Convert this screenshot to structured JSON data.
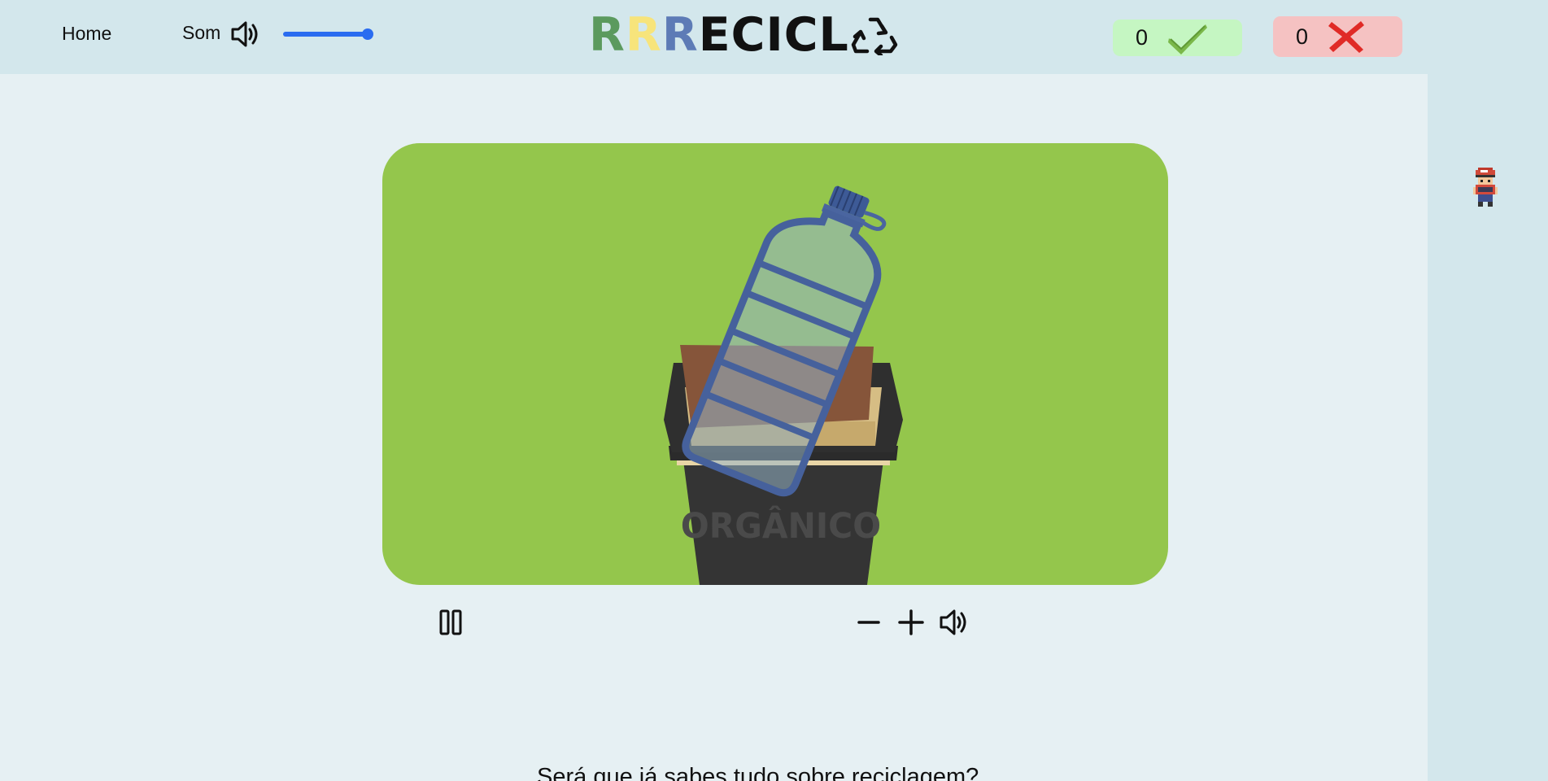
{
  "header": {
    "nav_home": "Home",
    "sound_label": "Som",
    "volume_level_percent": 100,
    "logo": {
      "r1": "R",
      "r2": "R",
      "r3": "R",
      "word": "ECICL",
      "r_colors": [
        "#5b9a5e",
        "#f7e47b",
        "#5d7bb6"
      ],
      "recycle_icon": "recycle-icon"
    },
    "score": {
      "correct": "0",
      "wrong": "0",
      "correct_icon": "check-icon",
      "wrong_icon": "cross-icon",
      "correct_bg": "#c5f6c2",
      "wrong_bg": "#f5c2c2"
    }
  },
  "video": {
    "stage_bg": "#94c64c",
    "bin_label": "ORGÂNICO",
    "item_icon": "plastic-bottle-icon"
  },
  "controls": {
    "pause_icon": "pause-icon",
    "zoom_out_icon": "minus-icon",
    "zoom_in_icon": "plus-icon",
    "audio_icon": "speaker-icon"
  },
  "main": {
    "question": "Será que já sabes tudo sobre reciclagem?"
  },
  "sidebar": {
    "mascot_icon": "pixel-character-icon"
  }
}
